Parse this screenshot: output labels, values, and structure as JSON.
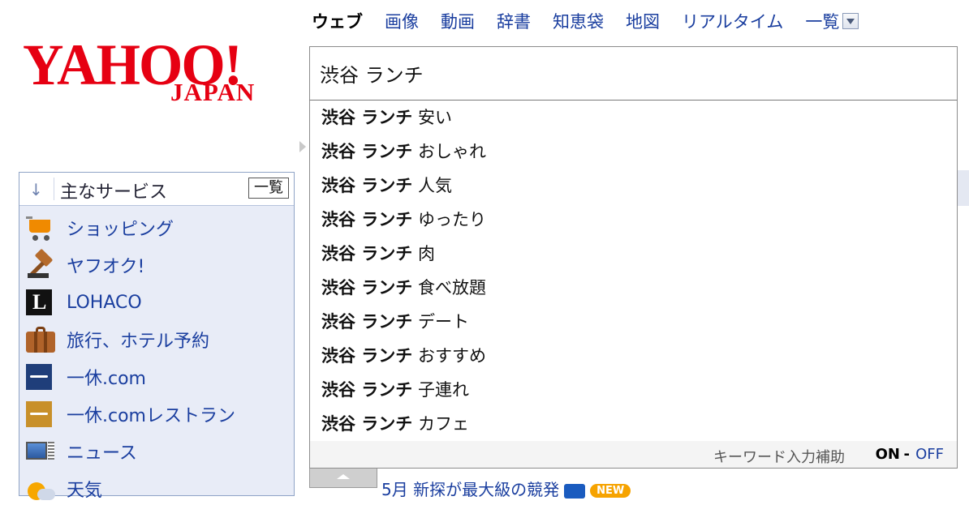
{
  "logo": {
    "main": "YAHOO!",
    "sub": "JAPAN"
  },
  "tabs": [
    {
      "label": "ウェブ",
      "active": true
    },
    {
      "label": "画像"
    },
    {
      "label": "動画"
    },
    {
      "label": "辞書"
    },
    {
      "label": "知恵袋"
    },
    {
      "label": "地図"
    },
    {
      "label": "リアルタイム"
    }
  ],
  "tab_more": "一覧",
  "search": {
    "value": "渋谷 ランチ"
  },
  "suggestions": {
    "prefix": "渋谷 ランチ",
    "items": [
      "安い",
      "おしゃれ",
      "人気",
      "ゆったり",
      "肉",
      "食べ放題",
      "デート",
      "おすすめ",
      "子連れ",
      "カフェ"
    ],
    "assist_label": "キーワード入力補助",
    "on": "ON",
    "separator": "-",
    "off": "OFF"
  },
  "sidebar": {
    "title": "主なサービス",
    "list_button": "一覧",
    "items": [
      {
        "label": "ショッピング",
        "icon": "shopping-cart-icon"
      },
      {
        "label": "ヤフオク!",
        "icon": "auction-gavel-icon"
      },
      {
        "label": "LOHACO",
        "icon": "lohaco-icon"
      },
      {
        "label": "旅行、ホテル予約",
        "icon": "travel-bag-icon"
      },
      {
        "label": "一休.com",
        "icon": "ikyu-icon"
      },
      {
        "label": "一休.comレストラン",
        "icon": "ikyu-restaurant-icon"
      },
      {
        "label": "ニュース",
        "icon": "news-icon"
      },
      {
        "label": "天気",
        "icon": "weather-icon"
      }
    ]
  },
  "news": {
    "text": "5月 新探が最大級の競発",
    "badge": "NEW"
  },
  "colors": {
    "brand": "#e60012",
    "link": "#1a3e9f"
  }
}
